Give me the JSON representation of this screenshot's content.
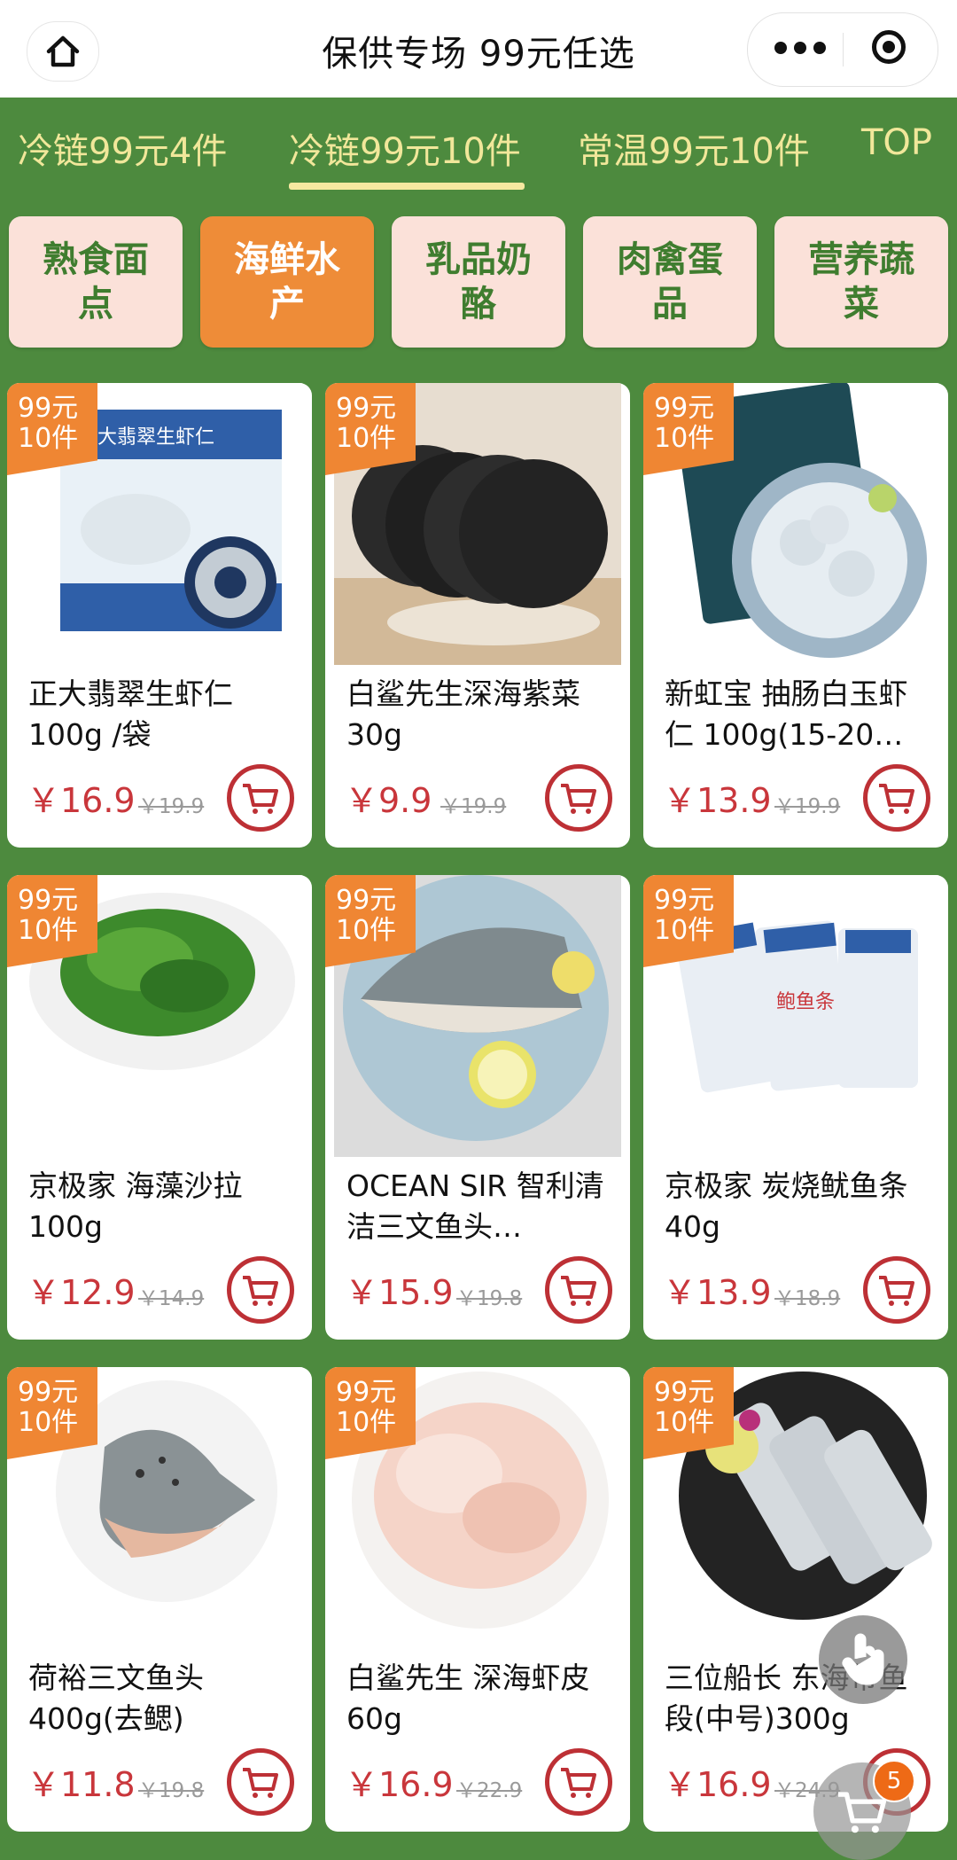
{
  "header": {
    "title": "保供专场 99元任选"
  },
  "tabs": [
    {
      "label": "冷链99元4件"
    },
    {
      "label": "冷链99元10件"
    },
    {
      "label": "常温99元10件"
    },
    {
      "label": "TOP"
    }
  ],
  "active_tab": "冷链99元10件",
  "categories": [
    {
      "label": "熟食面点"
    },
    {
      "label": "海鲜水产"
    },
    {
      "label": "乳品奶酪"
    },
    {
      "label": "肉禽蛋品"
    },
    {
      "label": "营养蔬菜"
    }
  ],
  "active_category": "海鲜水产",
  "products": [
    {
      "badge_line1": "99元",
      "badge_line2": "10件",
      "name": "正大翡翠生虾仁100g /袋",
      "price": "￥16.9",
      "original_price": "￥19.9",
      "package_text": "正大翡翠生虾仁"
    },
    {
      "badge_line1": "99元",
      "badge_line2": "10件",
      "name": "白鲨先生深海紫菜30g",
      "price": "￥9.9",
      "original_price": "￥19.9"
    },
    {
      "badge_line1": "99元",
      "badge_line2": "10件",
      "name": "新虹宝 抽肠白玉虾仁 100g(15-20…",
      "price": "￥13.9",
      "original_price": "￥19.9"
    },
    {
      "badge_line1": "99元",
      "badge_line2": "10件",
      "name": "京极家 海藻沙拉100g",
      "price": "￥12.9",
      "original_price": "￥14.9"
    },
    {
      "badge_line1": "99元",
      "badge_line2": "10件",
      "name": "OCEAN SIR 智利清洁三文鱼头…",
      "price": "￥15.9",
      "original_price": "￥19.8"
    },
    {
      "badge_line1": "99元",
      "badge_line2": "10件",
      "name": "京极家 炭烧鱿鱼条40g",
      "price": "￥13.9",
      "original_price": "￥18.9",
      "package_text": "鲍鱼条"
    },
    {
      "badge_line1": "99元",
      "badge_line2": "10件",
      "name": "荷裕三文鱼头400g(去鳃)",
      "price": "￥11.8",
      "original_price": "￥19.8"
    },
    {
      "badge_line1": "99元",
      "badge_line2": "10件",
      "name": "白鲨先生 深海虾皮60g",
      "price": "￥16.9",
      "original_price": "￥22.9"
    },
    {
      "badge_line1": "99元",
      "badge_line2": "10件",
      "name": "三位船长 东海带鱼段(中号)300g",
      "price": "￥16.9",
      "original_price": "￥24.9"
    }
  ],
  "cart": {
    "count": "5"
  },
  "colors": {
    "theme_green": "#4d8a3e",
    "accent_orange": "#ef8633",
    "price_red": "#c9363b",
    "tab_text": "#f1e79a"
  },
  "icons": [
    "home-icon",
    "more-dots-icon",
    "target-icon",
    "cart-icon",
    "touch-icon"
  ]
}
